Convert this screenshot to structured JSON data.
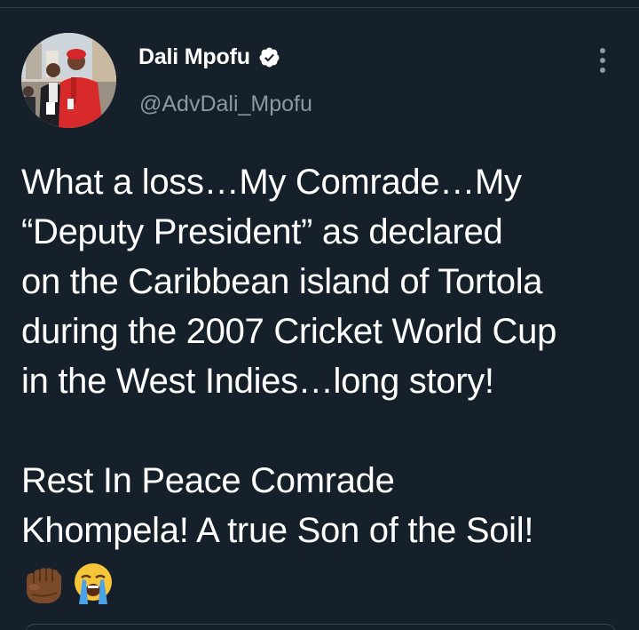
{
  "tweet": {
    "author": {
      "display_name": "Dali Mpofu",
      "handle": "@AdvDali_Mpofu",
      "verified": true
    },
    "text": {
      "lines_p1": [
        "What a loss…My Comrade…My",
        "“Deputy President” as declared",
        "on the Caribbean island of Tortola",
        "during the 2007 Cricket World Cup",
        "in the West Indies…long story!"
      ],
      "lines_p2": [
        "Rest In Peace Comrade",
        "Khompela! A true Son of the Soil!"
      ],
      "emojis": [
        "raised-fist-dark-skin-icon",
        "loudly-crying-face-icon"
      ]
    }
  },
  "colors": {
    "background": "#15202b",
    "text": "#ffffff",
    "secondary_text": "#8b98a5",
    "verified_badge": "#ffffff"
  }
}
